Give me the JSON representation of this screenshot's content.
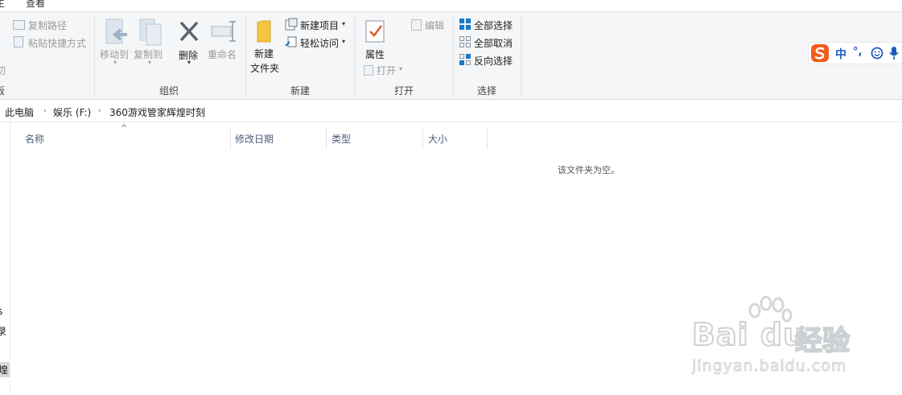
{
  "tabs": {
    "left_fragment": "主",
    "view": "查看"
  },
  "ribbon": {
    "clipboard": {
      "copy_path": "复制路径",
      "paste_shortcut": "粘贴快捷方式",
      "cut_fragment": "切",
      "group_fragment": "板"
    },
    "organize": {
      "move_to": "移动到",
      "copy_to": "复制到",
      "delete": "删除",
      "rename": "重命名",
      "group_label": "组织"
    },
    "new": {
      "new_folder_line1": "新建",
      "new_folder_line2": "文件夹",
      "new_item": "新建项目",
      "easy_access": "轻松访问",
      "group_label": "新建"
    },
    "open": {
      "properties": "属性",
      "open": "打开",
      "edit": "编辑",
      "group_label": "打开"
    },
    "select": {
      "select_all": "全部选择",
      "select_none": "全部取消",
      "invert_selection": "反向选择",
      "group_label": "选择"
    }
  },
  "breadcrumb": {
    "items": [
      "此电脑",
      "娱乐 (F:)",
      "360游戏管家辉煌时刻"
    ]
  },
  "columns": {
    "name": "名称",
    "date_modified": "修改日期",
    "type": "类型",
    "size": "大小"
  },
  "empty_message": "该文件夹为空。",
  "nav_fragments": [
    "s",
    "录",
    "煌"
  ],
  "ime": {
    "mode": "中",
    "punct": "°,",
    "emoji": "☺",
    "mic": "mic"
  },
  "watermark": {
    "brand": "Bai du",
    "sub": "经验",
    "url": "jingyan.baidu.com"
  },
  "colors": {
    "ribbon_bg": "#f5f6f7",
    "accent_blue": "#1979ca",
    "header_text": "#4c607a",
    "sogou_orange": "#f25c19"
  }
}
